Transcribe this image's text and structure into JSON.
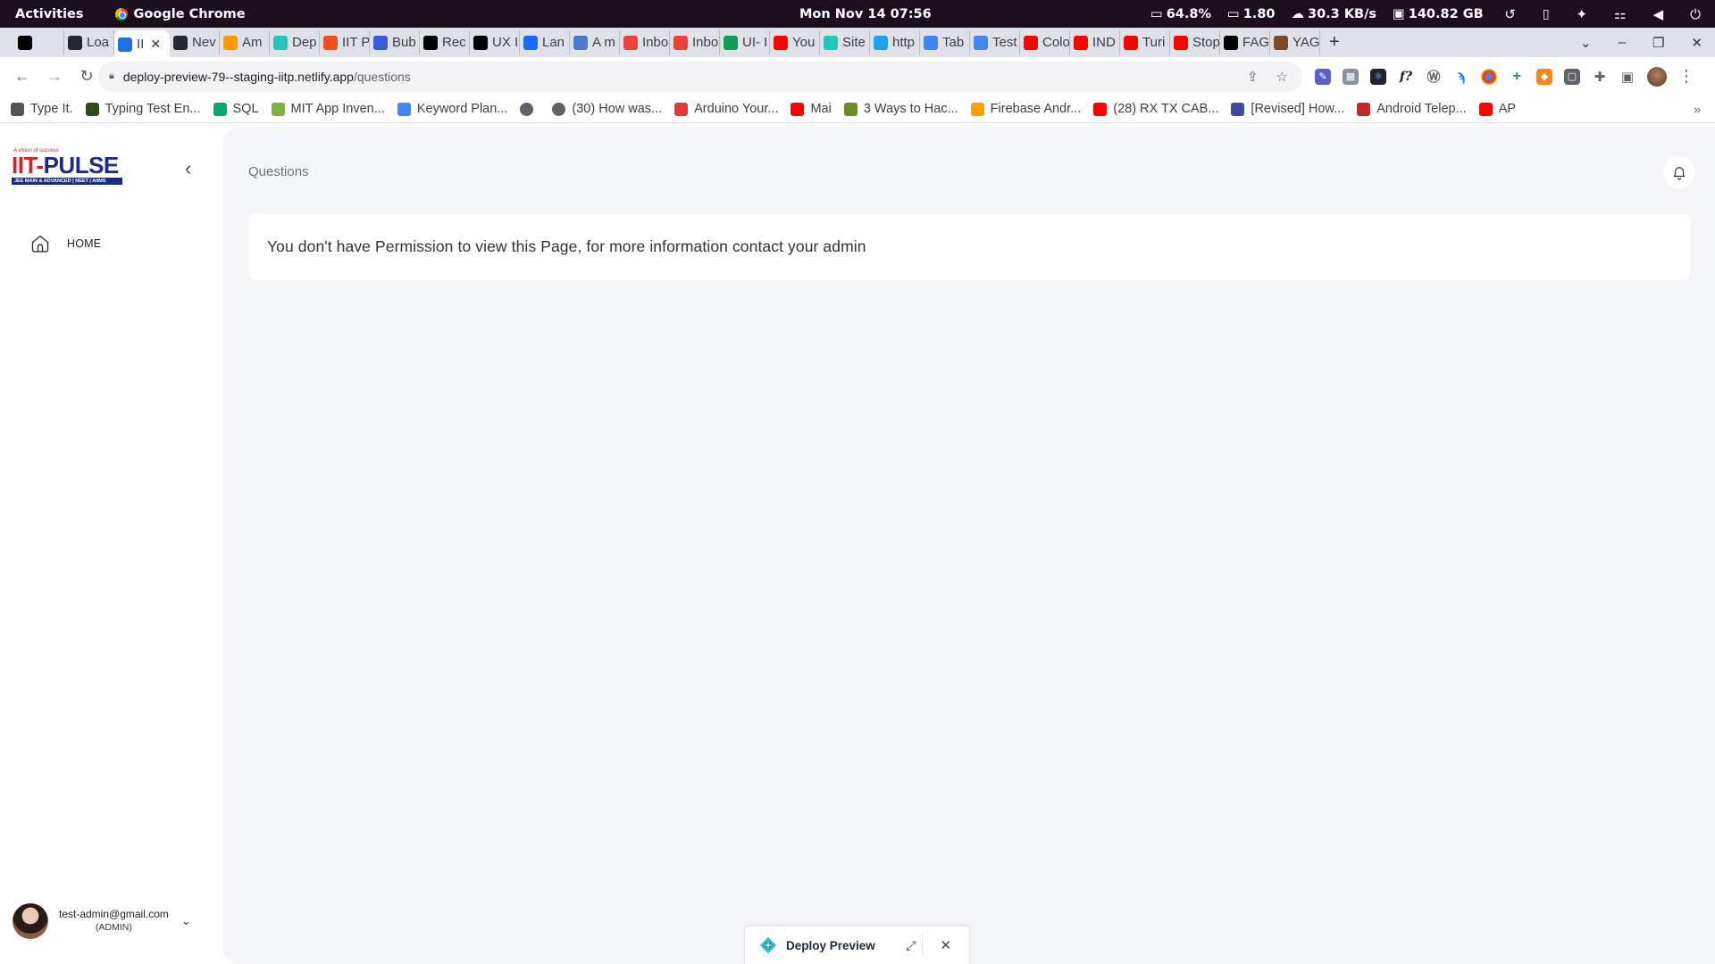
{
  "os_bar": {
    "activities": "Activities",
    "app_name": "Google Chrome",
    "clock": "Mon Nov 14  07:56",
    "battery": "64.8%",
    "load": "1.80",
    "network": "30.3 KB/s",
    "disk": "140.82 GB"
  },
  "tabs": [
    {
      "label": "",
      "icon": "notion-icon",
      "color": "#000000"
    },
    {
      "label": "Loa",
      "icon": "github-icon",
      "color": "#24292e"
    },
    {
      "label": "II",
      "icon": "pulse-icon",
      "color": "#1a73e8",
      "active": true
    },
    {
      "label": "Nev",
      "icon": "github-icon",
      "color": "#24292e"
    },
    {
      "label": "Am",
      "icon": "aws-icon",
      "color": "#ff9900"
    },
    {
      "label": "Dep",
      "icon": "netlify-icon",
      "color": "#20c6b7"
    },
    {
      "label": "IIT P",
      "icon": "figma-icon",
      "color": "#f24e1e"
    },
    {
      "label": "Bub",
      "icon": "bubble-icon",
      "color": "#3b5bdb"
    },
    {
      "label": "Rec",
      "icon": "medium-icon",
      "color": "#000000"
    },
    {
      "label": "UX I",
      "icon": "notion-icon",
      "color": "#000000"
    },
    {
      "label": "Lan",
      "icon": "behance-icon",
      "color": "#1769ff"
    },
    {
      "label": "A m",
      "icon": "translate-icon",
      "color": "#4a7bd0"
    },
    {
      "label": "Inbo",
      "icon": "gmail-icon",
      "color": "#ea4335"
    },
    {
      "label": "Inbo",
      "icon": "gmail-icon",
      "color": "#ea4335"
    },
    {
      "label": "UI- I",
      "icon": "sheets-icon",
      "color": "#0f9d58"
    },
    {
      "label": "You",
      "icon": "youtube-music-icon",
      "color": "#ff0000"
    },
    {
      "label": "Site",
      "icon": "sitemap-icon",
      "color": "#20c6b7"
    },
    {
      "label": "http",
      "icon": "twitter-icon",
      "color": "#1da1f2"
    },
    {
      "label": "Tab",
      "icon": "diamond-icon",
      "color": "#4285f4"
    },
    {
      "label": "Test",
      "icon": "docs-icon",
      "color": "#4285f4"
    },
    {
      "label": "Colo",
      "icon": "youtube-icon",
      "color": "#ff0000"
    },
    {
      "label": "IND",
      "icon": "youtube-icon",
      "color": "#ff0000"
    },
    {
      "label": "Turi",
      "icon": "youtube-icon",
      "color": "#ff0000"
    },
    {
      "label": "Stop",
      "icon": "youtube-icon",
      "color": "#ff0000"
    },
    {
      "label": "FAG",
      "icon": "figma-icon",
      "color": "#000000"
    },
    {
      "label": "YAG",
      "icon": "yag-icon",
      "color": "#7a4a2a"
    }
  ],
  "toolbar": {
    "url_host": "deploy-preview-79--staging-iitp.netlify.app",
    "url_path": "/questions"
  },
  "bookmarks": [
    {
      "label": "Type It.",
      "icon": "typeit-icon",
      "color": "#555555"
    },
    {
      "label": "Typing Test En...",
      "icon": "typing-icon",
      "color": "#2e4a1e"
    },
    {
      "label": "SQL",
      "icon": "w3schools-icon",
      "color": "#04aa6d"
    },
    {
      "label": "MIT App Inven...",
      "icon": "mit-icon",
      "color": "#7cb342"
    },
    {
      "label": "Keyword Plan...",
      "icon": "google-icon",
      "color": "#4285f4"
    },
    {
      "label": "",
      "icon": "globe-icon",
      "color": "#5f6368"
    },
    {
      "label": "(30) How was...",
      "icon": "globe-icon",
      "color": "#5f6368"
    },
    {
      "label": "Arduino Your...",
      "icon": "arduino-icon",
      "color": "#e53935"
    },
    {
      "label": "Mai",
      "icon": "youtube-icon",
      "color": "#ff0000"
    },
    {
      "label": "3 Ways to Hac...",
      "icon": "wikihow-icon",
      "color": "#6b8e23"
    },
    {
      "label": "Firebase Andr...",
      "icon": "firebase-icon",
      "color": "#ffa000"
    },
    {
      "label": "(28) RX TX CAB...",
      "icon": "youtube-icon",
      "color": "#ff0000"
    },
    {
      "label": "[Revised] How...",
      "icon": "revised-icon",
      "color": "#3c4b9a"
    },
    {
      "label": "Android Telep...",
      "icon": "android-icon",
      "color": "#c62828"
    },
    {
      "label": "AP",
      "icon": "youtube-icon",
      "color": "#ff0000"
    }
  ],
  "sidebar": {
    "logo_tagline": "A vision of success",
    "logo_word_a": "IIT",
    "logo_word_b": "-",
    "logo_word_c": "PULSE",
    "logo_strap": "JEE MAIN & ADVANCED | NEET | AIIMS",
    "home_label": "HOME",
    "user_email": "test-admin@gmail.com",
    "user_role": "(ADMIN)"
  },
  "main": {
    "breadcrumb": "Questions",
    "notice": "You don't have Permission to view this Page, for more information contact your admin"
  },
  "deploy_bar": {
    "label": "Deploy Preview"
  }
}
